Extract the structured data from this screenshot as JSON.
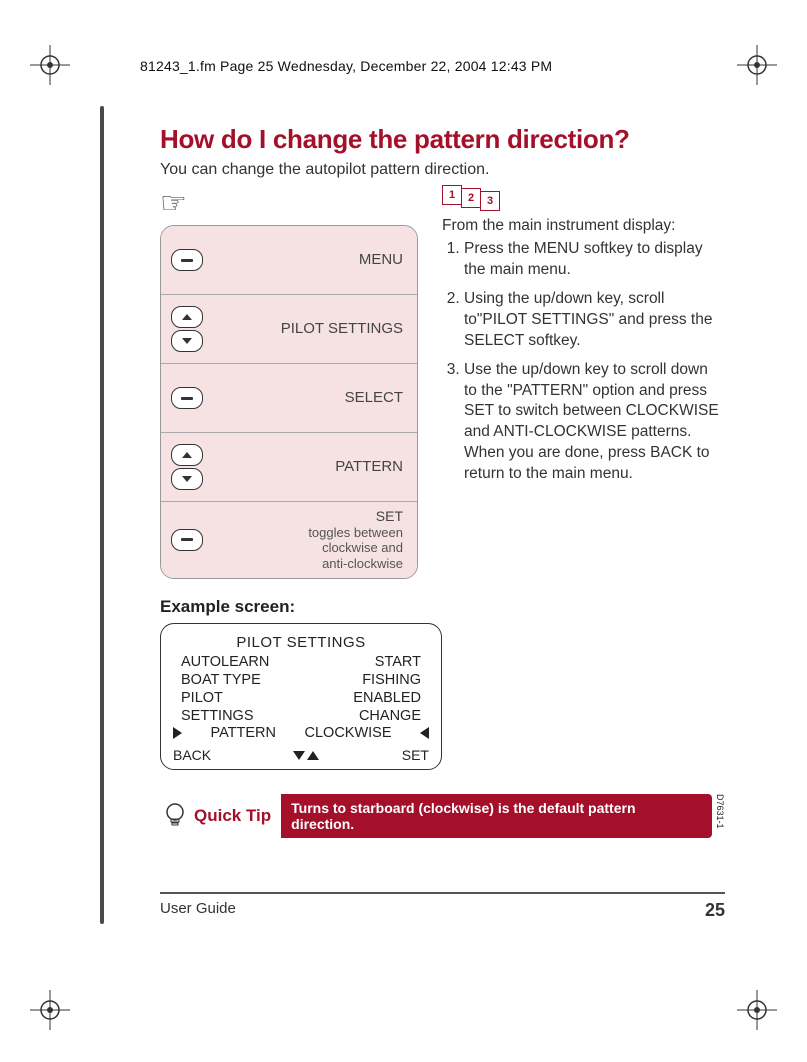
{
  "header": {
    "runline": "81243_1.fm  Page 25  Wednesday, December 22, 2004  12:43 PM"
  },
  "title": "How do I change the pattern direction?",
  "intro": "You can change the autopilot pattern direction.",
  "stepbox": {
    "r1": "MENU",
    "r2": "PILOT SETTINGS",
    "r3": "SELECT",
    "r4": "PATTERN",
    "r5": "SET",
    "r5sub1": "toggles between",
    "r5sub2": "clockwise and",
    "r5sub3": "anti-clockwise"
  },
  "exampleTitle": "Example screen:",
  "lcd": {
    "title": "PILOT SETTINGS",
    "rows": [
      {
        "l": "AUTOLEARN",
        "r": "START"
      },
      {
        "l": "BOAT TYPE",
        "r": "FISHING"
      },
      {
        "l": "PILOT",
        "r": "ENABLED"
      },
      {
        "l": "SETTINGS",
        "r": "CHANGE"
      }
    ],
    "sel": {
      "l": "PATTERN",
      "r": "CLOCKWISE"
    },
    "footL": "BACK",
    "footR": "SET"
  },
  "numicons": [
    "1",
    "2",
    "3"
  ],
  "instructions": {
    "lead": "From the main instrument display:",
    "items": [
      "Press the MENU softkey to display the main menu.",
      "Using the up/down key, scroll to\"PILOT SETTINGS\" and press the SELECT softkey.",
      "Use the up/down key to scroll down to the \"PATTERN\" option and press SET to switch between CLOCKWISE and ANTI-CLOCKWISE patterns. When you are done, press BACK to return to the main menu."
    ]
  },
  "tip": {
    "label": "Quick Tip",
    "text": "Turns to starboard (clockwise) is the default pattern direction.",
    "code": "D7631-1"
  },
  "footer": {
    "left": "User Guide",
    "page": "25"
  }
}
